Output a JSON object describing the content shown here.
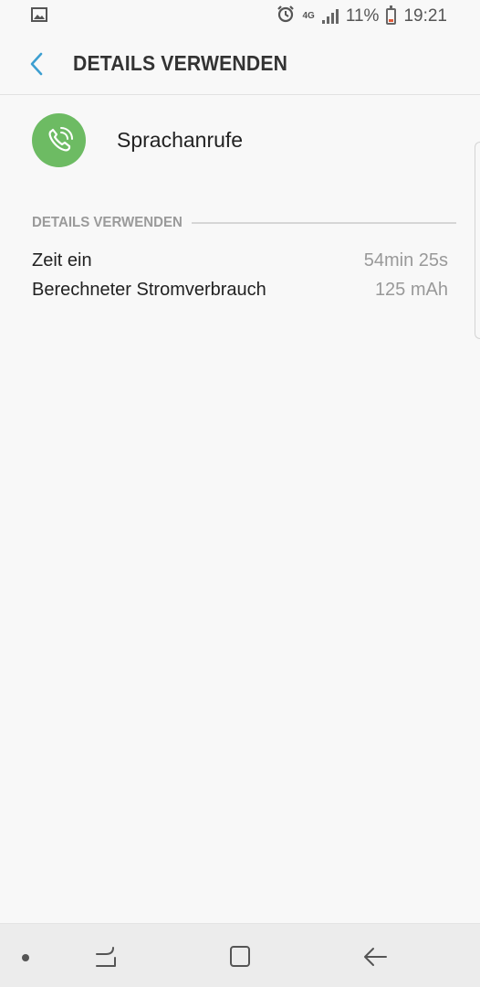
{
  "status_bar": {
    "network": "4G",
    "battery": "11%",
    "time": "19:21",
    "icons": [
      "image-icon",
      "alarm-icon",
      "signal-icon",
      "battery-icon"
    ]
  },
  "app_bar": {
    "title": "DETAILS VERWENDEN"
  },
  "app": {
    "name": "Sprachanrufe",
    "icon": "phone-call-icon",
    "icon_color": "#6dbb63"
  },
  "section": {
    "title": "DETAILS VERWENDEN",
    "rows": [
      {
        "label": "Zeit ein",
        "value": "54min 25s"
      },
      {
        "label": "Berechneter Stromverbrauch",
        "value": "125 mAh"
      }
    ]
  },
  "nav_bar": {
    "buttons": [
      "recents-icon",
      "home-icon",
      "back-icon"
    ]
  },
  "colors": {
    "accent": "#3d9fd1",
    "background": "#f8f8f8",
    "muted_text": "#999999"
  }
}
